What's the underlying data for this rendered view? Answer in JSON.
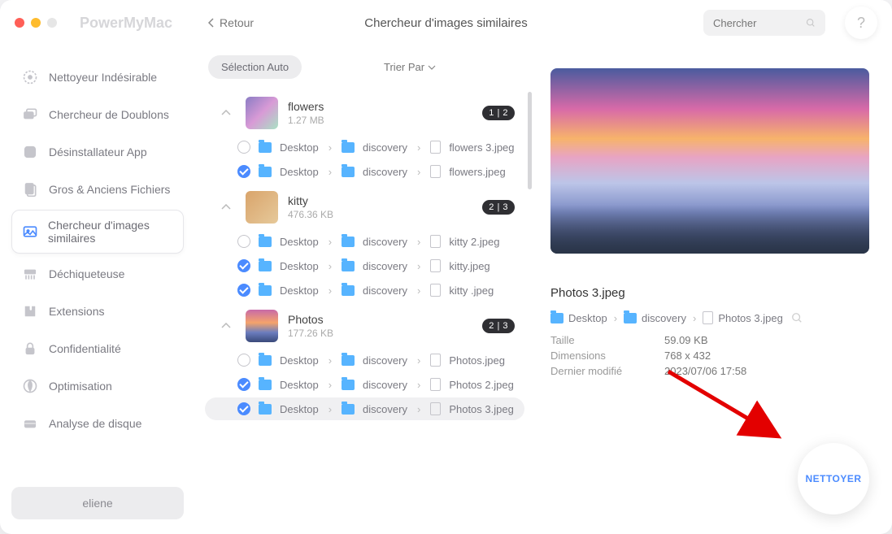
{
  "app_name": "PowerMyMac",
  "back_label": "Retour",
  "page_title": "Chercheur d'images similaires",
  "search_placeholder": "Chercher",
  "help_label": "?",
  "sidebar": {
    "items": [
      {
        "label": "Nettoyeur Indésirable"
      },
      {
        "label": "Chercheur de Doublons"
      },
      {
        "label": "Désinstallateur App"
      },
      {
        "label": "Gros & Anciens Fichiers"
      },
      {
        "label": "Chercheur d'images similaires"
      },
      {
        "label": "Déchiqueteuse"
      },
      {
        "label": "Extensions"
      },
      {
        "label": "Confidentialité"
      },
      {
        "label": "Optimisation"
      },
      {
        "label": "Analyse de disque"
      }
    ],
    "user": "eliene"
  },
  "toolbar": {
    "autoselect": "Sélection Auto",
    "sort": "Trier Par"
  },
  "path_segments": {
    "desktop": "Desktop",
    "discovery": "discovery"
  },
  "groups": [
    {
      "title": "flowers",
      "size": "1.27 MB",
      "badge": "1 | 2",
      "files": [
        {
          "name": "flowers 3.jpeg",
          "checked": false
        },
        {
          "name": "flowers.jpeg",
          "checked": true
        }
      ]
    },
    {
      "title": "kitty",
      "size": "476.36 KB",
      "badge": "2 | 3",
      "files": [
        {
          "name": "kitty 2.jpeg",
          "checked": false
        },
        {
          "name": "kitty.jpeg",
          "checked": true
        },
        {
          "name": "kitty .jpeg",
          "checked": true
        }
      ]
    },
    {
      "title": "Photos",
      "size": "177.26 KB",
      "badge": "2 | 3",
      "files": [
        {
          "name": "Photos.jpeg",
          "checked": false
        },
        {
          "name": "Photos 2.jpeg",
          "checked": true
        },
        {
          "name": "Photos 3.jpeg",
          "checked": true,
          "selected": true
        }
      ]
    }
  ],
  "preview": {
    "name": "Photos 3.jpeg",
    "path_file": "Photos 3.jpeg",
    "meta": {
      "size_k": "Taille",
      "size_v": "59.09 KB",
      "dim_k": "Dimensions",
      "dim_v": "768 x 432",
      "mod_k": "Dernier modifié",
      "mod_v": "2023/07/06 17:58"
    }
  },
  "clean_label": "NETTOYER"
}
